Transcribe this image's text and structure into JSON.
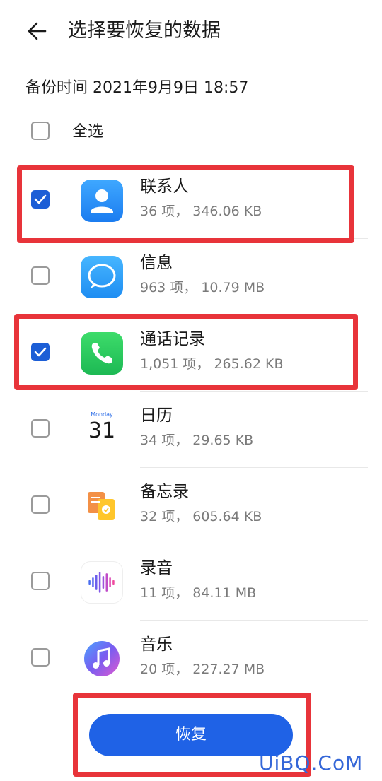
{
  "header": {
    "title": "选择要恢复的数据"
  },
  "backup_time": "备份时间 2021年9月9日 18:57",
  "select_all": {
    "label": "全选",
    "checked": false
  },
  "items": [
    {
      "name": "联系人",
      "meta": "36 项， 346.06 KB",
      "checked": true,
      "icon": "contacts-icon"
    },
    {
      "name": "信息",
      "meta": "963 项， 10.79 MB",
      "checked": false,
      "icon": "messages-icon"
    },
    {
      "name": "通话记录",
      "meta": "1,051 项， 265.62 KB",
      "checked": true,
      "icon": "phone-icon"
    },
    {
      "name": "日历",
      "meta": "34 项， 29.65 KB",
      "checked": false,
      "icon": "calendar-icon",
      "calendar": {
        "weekday": "Monday",
        "day": "31"
      }
    },
    {
      "name": "备忘录",
      "meta": "32 项， 605.64 KB",
      "checked": false,
      "icon": "notes-icon"
    },
    {
      "name": "录音",
      "meta": "11 项， 84.11 MB",
      "checked": false,
      "icon": "recorder-icon"
    },
    {
      "name": "音乐",
      "meta": "20 项， 227.27 MB",
      "checked": false,
      "icon": "music-icon"
    }
  ],
  "restore_button": {
    "label": "恢复"
  },
  "watermark": "UiBQ.CoM",
  "colors": {
    "accent": "#1f62e6",
    "highlight": "#e8343a",
    "checkbox_checked": "#1c5ed6"
  }
}
